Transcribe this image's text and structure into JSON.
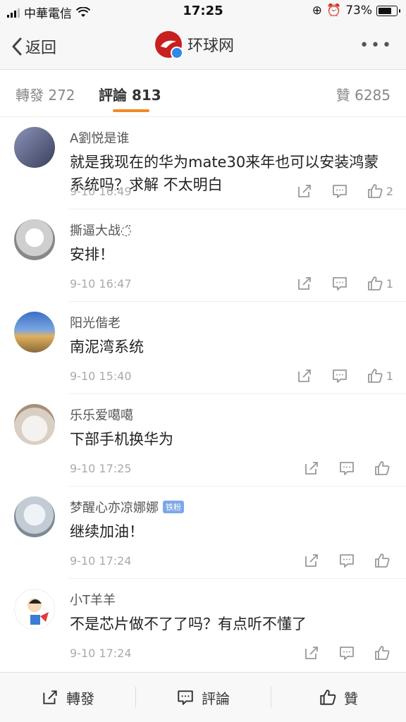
{
  "status": {
    "carrier": "中華電信",
    "time": "17:25",
    "battery": "73%",
    "battery_level": 0.73
  },
  "nav": {
    "back_label": "返回",
    "title": "环球网",
    "more": "•••"
  },
  "tabs": {
    "repost": "轉發 272",
    "comment": "評論 813",
    "like": "贊 6285"
  },
  "comments": [
    {
      "name": "A劉悦是谁",
      "text": "就是我现在的华为mate30来年也可以安装鸿蒙系统吗？求解 不太明白",
      "time": "9-10 16:49",
      "likes": "2"
    },
    {
      "name": "撕逼大战◌̈",
      "text": "安排！",
      "time": "9-10 16:47",
      "likes": "1"
    },
    {
      "name": "阳光偕老",
      "text": "南泥湾系统",
      "time": "9-10 15:40",
      "likes": "1"
    },
    {
      "name": "乐乐爱噶噶",
      "text": "下部手机换华为",
      "time": "9-10 17:25",
      "likes": ""
    },
    {
      "name": "梦醒心亦凉娜娜",
      "badge": "铁粉",
      "text": "继续加油！",
      "time": "9-10 17:24",
      "likes": ""
    },
    {
      "name": "小T羊羊",
      "text": "不是芯片做不了了吗？有点听不懂了",
      "time": "9-10 17:24",
      "likes": ""
    }
  ],
  "bottom": {
    "repost": "轉發",
    "comment": "評論",
    "like": "贊"
  },
  "colors": {
    "accent": "#f28a25",
    "brand": "#c8201e",
    "verified": "#2f89e7"
  }
}
